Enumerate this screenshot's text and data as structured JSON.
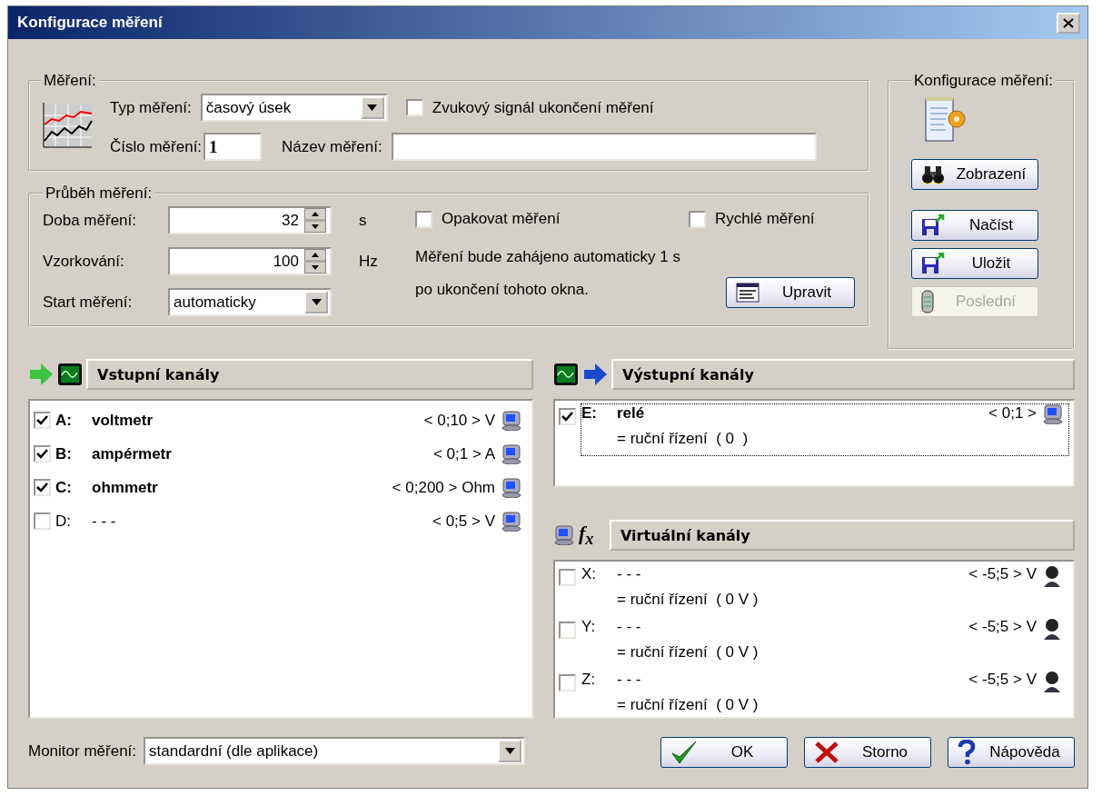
{
  "window": {
    "title": "Konfigurace měření"
  },
  "measurement": {
    "legend": "Měření:",
    "type_label": "Typ měření:",
    "type_value": "časový úsek",
    "sound": {
      "label": "Zvukový signál ukončení měření",
      "checked": false
    },
    "number_label": "Číslo měření:",
    "number_value": "1",
    "name_label": "Název měření:"
  },
  "progress": {
    "legend": "Průběh měření:",
    "duration": {
      "label": "Doba měření:",
      "value": "32",
      "unit": "s"
    },
    "sampling": {
      "label": "Vzorkování:",
      "value": "100",
      "unit": "Hz"
    },
    "start": {
      "label": "Start měření:",
      "value": "automaticky"
    },
    "repeat": {
      "label": "Opakovat měření",
      "checked": false
    },
    "fast": {
      "label": "Rychlé měření",
      "checked": false
    },
    "info": [
      "Měření bude zahájeno automaticky 1 s",
      "po ukončení tohoto okna."
    ],
    "edit_button": "Upravit"
  },
  "configuration": {
    "legend": "Konfigurace měření:",
    "buttons": [
      {
        "label": "Zobrazení",
        "kind": "view",
        "disabled": false
      },
      {
        "label": "Načíst",
        "kind": "load",
        "disabled": false
      },
      {
        "label": "Uložit",
        "kind": "save",
        "disabled": false
      },
      {
        "label": "Poslední",
        "kind": "last",
        "disabled": true
      }
    ]
  },
  "input_channels": {
    "title": "Vstupní kanály",
    "items": [
      {
        "id": "A:",
        "name": "voltmetr",
        "range": "< 0;10 > V",
        "checked": true
      },
      {
        "id": "B:",
        "name": "ampérmetr",
        "range": "< 0;1 > A",
        "checked": true
      },
      {
        "id": "C:",
        "name": "ohmmetr",
        "range": "< 0;200 > Ohm",
        "checked": true
      },
      {
        "id": "D:",
        "name": "- - -",
        "range": "< 0;5 > V",
        "checked": false
      }
    ]
  },
  "output_channels": {
    "title": "Výstupní kanály",
    "items": [
      {
        "id": "E:",
        "name": "relé",
        "range": "< 0;1 >",
        "control": "= ruční řízení  ( 0  )",
        "checked": true,
        "focused": true
      }
    ]
  },
  "virtual_channels": {
    "symbol": "f$_{x}$",
    "title": "Virtuální kanály",
    "items": [
      {
        "id": "X:",
        "name": "- - -",
        "range": "< -5;5 > V",
        "control": "= ruční řízení  ( 0 V )",
        "checked": false
      },
      {
        "id": "Y:",
        "name": "- - -",
        "range": "< -5;5 > V",
        "control": "= ruční řízení  ( 0 V )",
        "checked": false
      },
      {
        "id": "Z:",
        "name": "- - -",
        "range": "< -5;5 > V",
        "control": "= ruční řízení  ( 0 V )",
        "checked": false
      }
    ]
  },
  "monitor": {
    "label": "Monitor měření:",
    "value": "standardní (dle aplikace)"
  },
  "buttons": [
    {
      "label": "OK",
      "kind": "ok"
    },
    {
      "label": "Storno",
      "kind": "cancel"
    },
    {
      "label": "Nápověda",
      "kind": "help"
    }
  ]
}
